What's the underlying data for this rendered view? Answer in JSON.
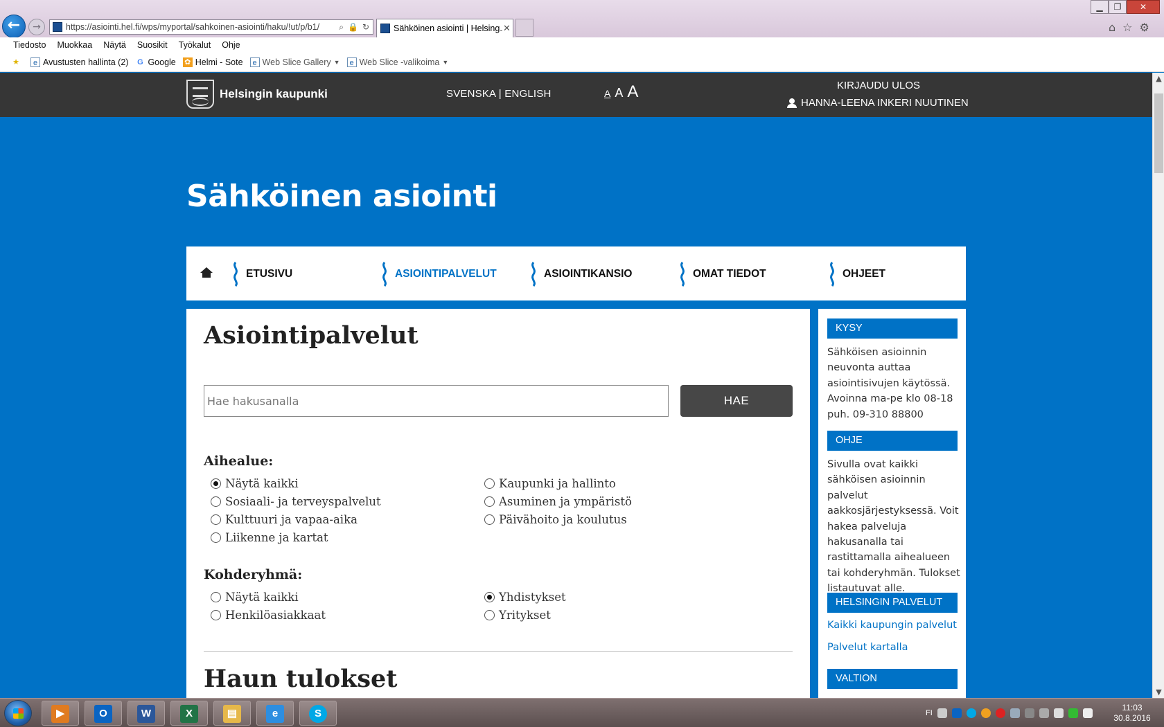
{
  "browser": {
    "url": "https://asiointi.hel.fi/wps/myportal/sahkoinen-asiointi/haku/!ut/p/b1/",
    "tab_title": "Sähköinen asiointi | Helsing...",
    "tab_close": "✕",
    "window_buttons": {
      "minimize": "▁",
      "maximize": "❐",
      "close": "✕"
    },
    "menu": [
      "Tiedosto",
      "Muokkaa",
      "Näytä",
      "Suosikit",
      "Työkalut",
      "Ohje"
    ],
    "favorites": [
      {
        "label": "Avustusten hallinta (2)",
        "icon": "ie-page-icon"
      },
      {
        "label": "Google",
        "icon": "google-icon"
      },
      {
        "label": "Helmi - Sote",
        "icon": "helmi-icon"
      },
      {
        "label": "Web Slice Gallery",
        "icon": "web-slice-icon"
      },
      {
        "label": "Web Slice -valikoima",
        "icon": "web-slice-icon"
      }
    ]
  },
  "header": {
    "logo_text": "Helsingin kaupunki",
    "languages": "SVENSKA | ENGLISH",
    "font_sizes": [
      "A",
      "A",
      "A"
    ],
    "logout": "KIRJAUDU ULOS",
    "username": "HANNA-LEENA INKERI NUUTINEN"
  },
  "hero": {
    "title": "Sähköinen asiointi"
  },
  "nav": {
    "items": [
      {
        "label": "ETUSIVU",
        "active": false
      },
      {
        "label": "ASIOINTIPALVELUT",
        "active": true
      },
      {
        "label": "ASIOINTIKANSIO",
        "active": false
      },
      {
        "label": "OMAT TIEDOT",
        "active": false
      },
      {
        "label": "OHJEET",
        "active": false
      }
    ]
  },
  "main": {
    "title": "Asiointipalvelut",
    "search": {
      "placeholder": "Hae hakusanalla",
      "value": "",
      "button": "HAE"
    },
    "aihealue": {
      "heading": "Aihealue:",
      "options": [
        {
          "label": "Näytä kaikki",
          "checked": true
        },
        {
          "label": "Kaupunki ja hallinto",
          "checked": false
        },
        {
          "label": "Sosiaali- ja terveyspalvelut",
          "checked": false
        },
        {
          "label": "Asuminen ja ympäristö",
          "checked": false
        },
        {
          "label": "Kulttuuri ja vapaa-aika",
          "checked": false
        },
        {
          "label": "Päivähoito ja koulutus",
          "checked": false
        },
        {
          "label": "Liikenne ja kartat",
          "checked": false
        }
      ]
    },
    "kohderyhma": {
      "heading": "Kohderyhmä:",
      "options": [
        {
          "label": "Näytä kaikki",
          "checked": false
        },
        {
          "label": "Yhdistykset",
          "checked": true
        },
        {
          "label": "Henkilöasiakkaat",
          "checked": false
        },
        {
          "label": "Yritykset",
          "checked": false
        }
      ]
    },
    "results_heading": "Haun tulokset"
  },
  "sidebar": {
    "kysy_heading": "KYSY",
    "kysy_text": "Sähköisen asioinnin neuvonta auttaa asiointisivujen käytössä. Avoinna ma-pe klo 08-18 puh. 09-310 88800",
    "ohje_heading": "OHJE",
    "ohje_text": "Sivulla ovat kaikki sähköisen asioinnin palvelut aakkosjärjestyksessä. Voit hakea palveluja hakusanalla tai rastittamalla aihealueen tai kohderyhmän. Tulokset listautuvat alle.",
    "helsinki_heading": "HELSINGIN PALVELUT",
    "links": [
      "Kaikki kaupungin palvelut",
      "Palvelut kartalla"
    ],
    "valtion_heading": "VALTION"
  },
  "taskbar": {
    "apps": [
      {
        "name": "media-player-icon",
        "glyph": "▶",
        "color": "#e07b20"
      },
      {
        "name": "outlook-icon",
        "glyph": "O",
        "color": "#0a64c2"
      },
      {
        "name": "word-icon",
        "glyph": "W",
        "color": "#2b579a"
      },
      {
        "name": "excel-icon",
        "glyph": "X",
        "color": "#217346"
      },
      {
        "name": "explorer-icon",
        "glyph": "▤",
        "color": "#e6b84a"
      },
      {
        "name": "internet-explorer-icon",
        "glyph": "e",
        "color": "#2d8ee0"
      },
      {
        "name": "skype-icon",
        "glyph": "S",
        "color": "#00a8e6"
      }
    ],
    "language": "FI",
    "time": "11:03",
    "date": "30.8.2016"
  }
}
